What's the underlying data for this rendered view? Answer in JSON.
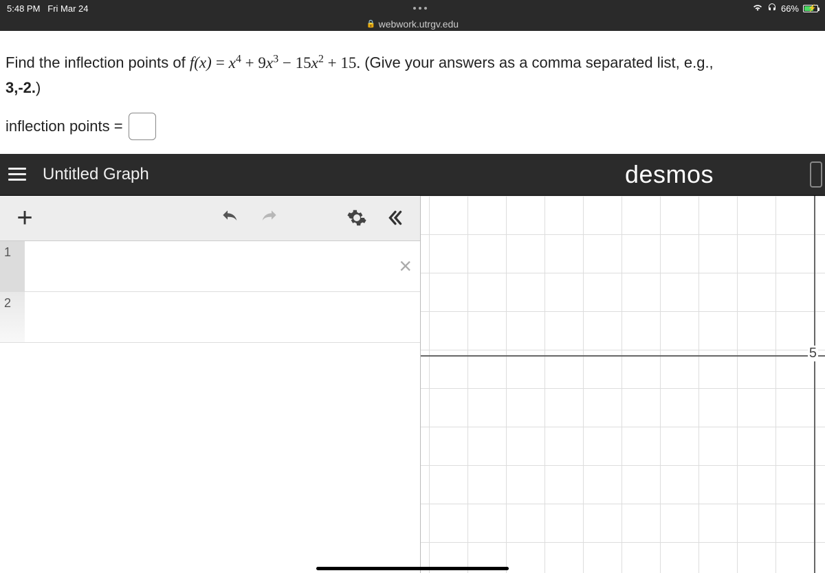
{
  "status_bar": {
    "time": "5:48 PM",
    "date": "Fri Mar 24",
    "battery_pct": "66%"
  },
  "url_bar": {
    "domain": "webwork.utrgv.edu"
  },
  "problem": {
    "prefix": "Find the inflection points of ",
    "fx": "f(x)",
    "equals": " = ",
    "expr_html": "x⁴ + 9x³ − 15x² + 15.",
    "suffix": " (Give your answers as a comma separated list, e.g.,",
    "example": "3,-2.",
    "close_paren": ")",
    "answer_label": "inflection points ="
  },
  "desmos": {
    "title": "Untitled Graph",
    "logo": "desmos",
    "rows": [
      {
        "num": "1"
      },
      {
        "num": "2"
      }
    ],
    "axis_label": "5"
  }
}
